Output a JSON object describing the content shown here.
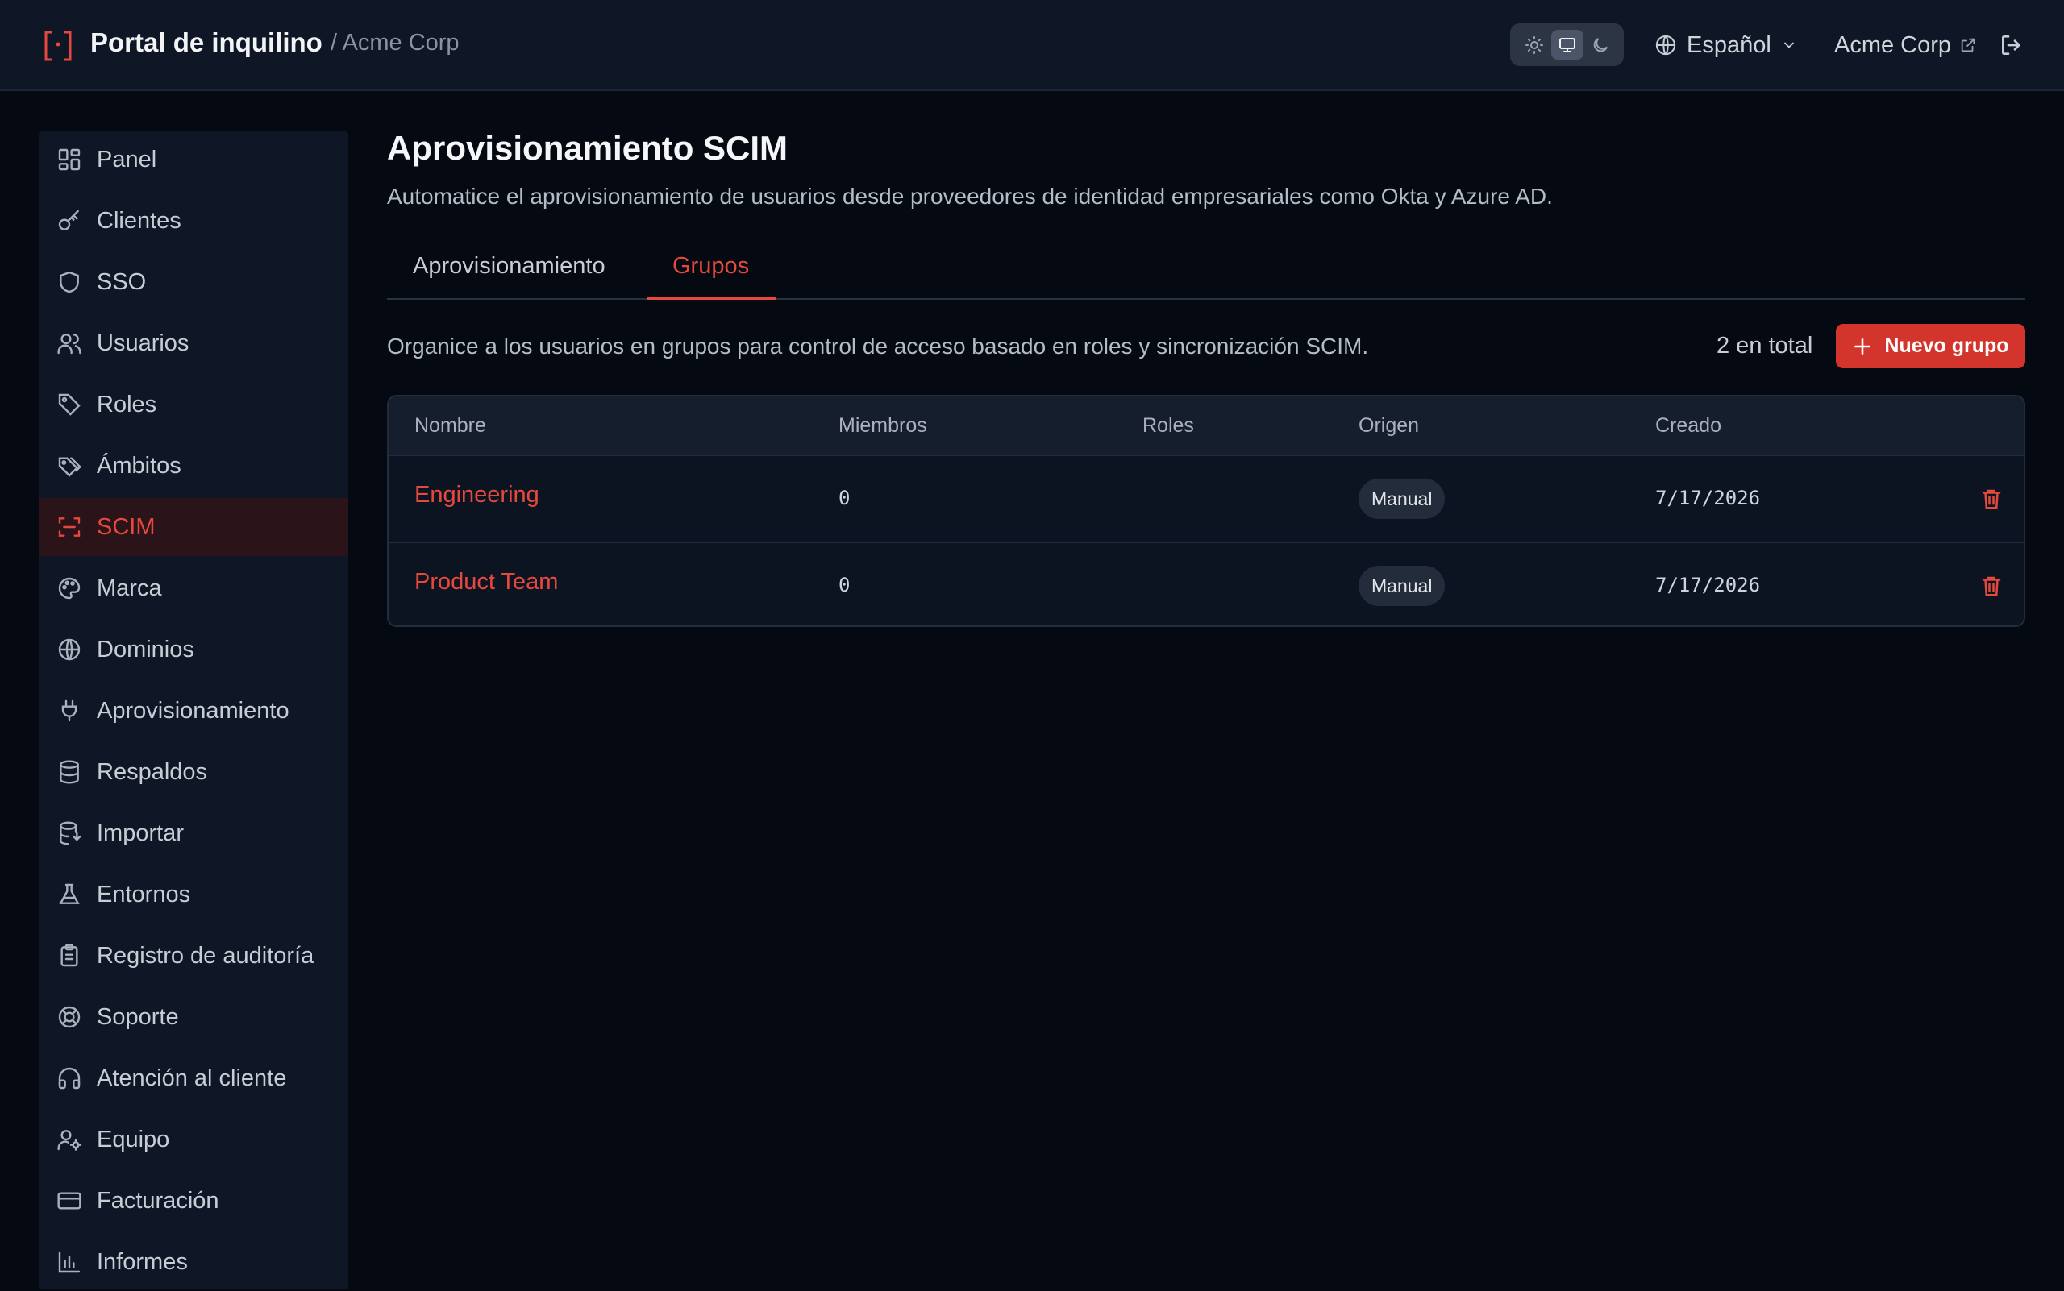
{
  "header": {
    "app_title": "Portal de inquilino",
    "breadcrumb": "/ Acme Corp",
    "theme_options": [
      "light",
      "system",
      "dark"
    ],
    "theme_selected": "system",
    "language": "Español",
    "org_link": "Acme Corp"
  },
  "sidebar": {
    "items": [
      {
        "label": "Panel",
        "icon": "dashboard-icon"
      },
      {
        "label": "Clientes",
        "icon": "key-icon"
      },
      {
        "label": "SSO",
        "icon": "shield-icon"
      },
      {
        "label": "Usuarios",
        "icon": "users-icon"
      },
      {
        "label": "Roles",
        "icon": "tag-icon"
      },
      {
        "label": "Ámbitos",
        "icon": "tags-icon"
      },
      {
        "label": "SCIM",
        "icon": "scan-icon",
        "active": true
      },
      {
        "label": "Marca",
        "icon": "palette-icon"
      },
      {
        "label": "Dominios",
        "icon": "globe-icon"
      },
      {
        "label": "Aprovisionamiento",
        "icon": "plug-icon"
      },
      {
        "label": "Respaldos",
        "icon": "database-icon"
      },
      {
        "label": "Importar",
        "icon": "database-import-icon"
      },
      {
        "label": "Entornos",
        "icon": "flask-icon"
      },
      {
        "label": "Registro de auditoría",
        "icon": "clipboard-icon"
      },
      {
        "label": "Soporte",
        "icon": "lifebuoy-icon"
      },
      {
        "label": "Atención al cliente",
        "icon": "headphones-icon"
      },
      {
        "label": "Equipo",
        "icon": "user-cog-icon"
      },
      {
        "label": "Facturación",
        "icon": "credit-card-icon"
      },
      {
        "label": "Informes",
        "icon": "bar-chart-icon"
      }
    ]
  },
  "main": {
    "title": "Aprovisionamiento SCIM",
    "subtitle": "Automatice el aprovisionamiento de usuarios desde proveedores de identidad empresariales como Okta y Azure AD.",
    "tabs": [
      {
        "label": "Aprovisionamiento",
        "active": false
      },
      {
        "label": "Grupos",
        "active": true
      }
    ],
    "groups_description": "Organice a los usuarios en grupos para control de acceso basado en roles y sincronización SCIM.",
    "total": "2 en total",
    "new_group_label": "Nuevo grupo",
    "table": {
      "columns": [
        "Nombre",
        "Miembros",
        "Roles",
        "Origen",
        "Creado"
      ],
      "rows": [
        {
          "name": "Engineering",
          "members": "0",
          "roles": "",
          "origin": "Manual",
          "created": "7/17/2026"
        },
        {
          "name": "Product Team",
          "members": "0",
          "roles": "",
          "origin": "Manual",
          "created": "7/17/2026"
        }
      ]
    }
  },
  "colors": {
    "accent": "#e5483d",
    "button_bg": "#d3342b",
    "background": "#050a12",
    "panel": "#0f1726"
  }
}
